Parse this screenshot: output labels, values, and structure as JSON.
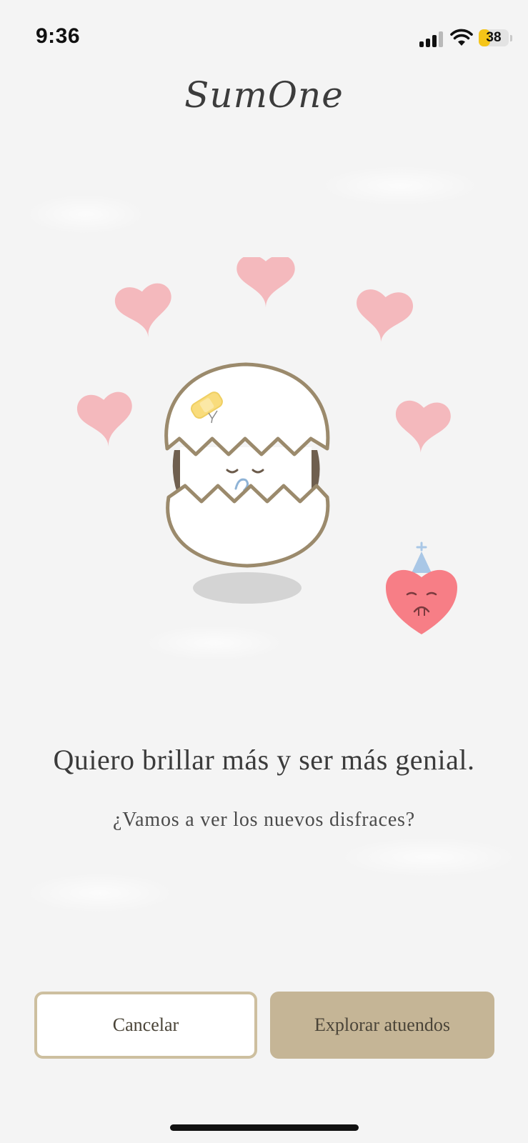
{
  "status_bar": {
    "time": "9:36",
    "battery_level": "38",
    "icons": [
      "signal-icon",
      "wifi-icon",
      "battery-icon"
    ]
  },
  "app": {
    "logo": "SumOne"
  },
  "illustration": {
    "description_icons": [
      "heart-icon",
      "hatching-egg-character",
      "party-hat-heart-character"
    ],
    "colors": {
      "heart_pink": "#f5b6bb",
      "egg_outline": "#9b8a6c",
      "red_heart": "#f77e86",
      "party_hat": "#a9c7e6"
    }
  },
  "message": {
    "headline": "Quiero brillar más y ser más genial.",
    "subline": "¿Vamos a ver los nuevos disfraces?"
  },
  "actions": {
    "cancel_label": "Cancelar",
    "explore_label": "Explorar atuendos"
  },
  "colors": {
    "accent": "#c5b596",
    "button_border": "#cdbf9f",
    "background": "#f4f4f4"
  }
}
